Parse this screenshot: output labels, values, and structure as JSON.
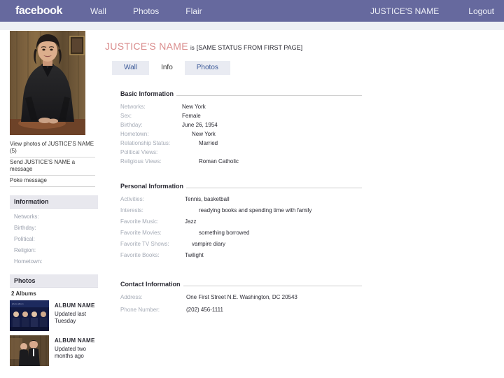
{
  "topbar": {
    "brand": "facebook",
    "nav": [
      {
        "label": "Wall"
      },
      {
        "label": "Photos"
      },
      {
        "label": "Flair"
      }
    ],
    "account_name": "JUSTICE'S NAME",
    "logout_label": "Logout",
    "bar_color": "#66699e"
  },
  "profile": {
    "name": "JUSTICE'S NAME",
    "status_verb": "is",
    "status_text": "[SAME STATUS FROM FIRST PAGE]",
    "name_color": "#d98b8b",
    "photo_alt": "portrait-of-justice-in-black-judicial-robe"
  },
  "tabs": [
    {
      "label": "Wall",
      "active": false
    },
    {
      "label": "Info",
      "active": true
    },
    {
      "label": "Photos",
      "active": false
    }
  ],
  "sidebar": {
    "photo_links": [
      {
        "label": "View photos of JUSTICE'S NAME (5)"
      },
      {
        "label": "Send JUSTICE'S NAME a message"
      },
      {
        "label": "Poke message"
      }
    ],
    "information_box": {
      "title": "Information",
      "fields": [
        {
          "label": "Networks:"
        },
        {
          "label": "Birthday:"
        },
        {
          "label": "Political:"
        },
        {
          "label": "Religion:"
        },
        {
          "label": "Hometown:"
        }
      ]
    },
    "photos_box": {
      "title": "Photos",
      "album_count": "2 Albums",
      "albums": [
        {
          "name": "ALBUM NAME",
          "updated": "Updated last Tuesday",
          "thumb_alt": "group-photo-album-cover-dark-blue"
        },
        {
          "name": "ALBUM NAME",
          "updated": "Updated two months ago",
          "thumb_alt": "two-people-in-robes-in-library"
        }
      ]
    }
  },
  "main": {
    "basic_information": {
      "title": "Basic Information",
      "rows": [
        {
          "label": "Networks:",
          "value": "New York",
          "indent": "indent-1"
        },
        {
          "label": "Sex:",
          "value": "Female",
          "indent": "indent-1"
        },
        {
          "label": "Birthday:",
          "value": "June 26, 1954",
          "indent": "indent-1"
        },
        {
          "label": "Hometown:",
          "value": "New York",
          "indent": "indent-2"
        },
        {
          "label": "Relationship Status:",
          "value": "Married",
          "indent": "indent-3"
        },
        {
          "label": "Political Views:",
          "value": "",
          "indent": "indent-1"
        },
        {
          "label": "Religious Views:",
          "value": "Roman Catholic",
          "indent": "indent-3"
        }
      ]
    },
    "personal_information": {
      "title": "Personal Information",
      "rows": [
        {
          "label": "Activities:",
          "value": "Tennis, basketball",
          "indent": "indent-4"
        },
        {
          "label": "Interests:",
          "value": "readying books and spending time with family",
          "indent": "indent-3"
        },
        {
          "label": "Favorite Music:",
          "value": "Jazz",
          "indent": "indent-4"
        },
        {
          "label": "Favorite Movies:",
          "value": "something borrowed",
          "indent": "indent-3"
        },
        {
          "label": "Favorite TV Shows:",
          "value": "vampire diary",
          "indent": "indent-2"
        },
        {
          "label": "Favorite Books:",
          "value": "Twilight",
          "indent": "indent-4"
        }
      ]
    },
    "contact_information": {
      "title": "Contact Information",
      "rows": [
        {
          "label": "Address:",
          "value": "One First Street N.E. Washington, DC 20543",
          "indent": ""
        },
        {
          "label": "Phone Number:",
          "value": "(202) 456-1111",
          "indent": ""
        }
      ]
    }
  }
}
